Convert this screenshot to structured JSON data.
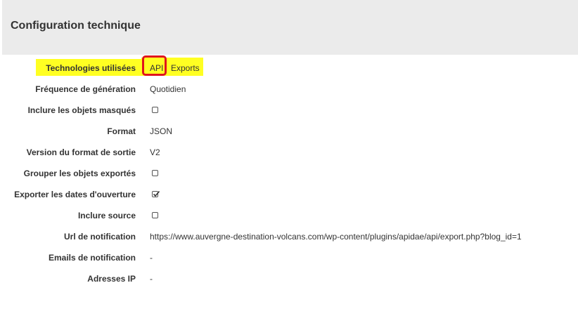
{
  "panel": {
    "title": "Configuration technique"
  },
  "fields": [
    {
      "label": "Technologies utilisées",
      "tags": [
        "API",
        "Exports"
      ]
    },
    {
      "label": "Fréquence de génération",
      "value": "Quotidien"
    },
    {
      "label": "Inclure les objets masqués",
      "checked": false
    },
    {
      "label": "Format",
      "value": "JSON"
    },
    {
      "label": "Version du format de sortie",
      "value": "V2"
    },
    {
      "label": "Grouper les objets exportés",
      "checked": false
    },
    {
      "label": "Exporter les dates d'ouverture",
      "checked": true
    },
    {
      "label": "Inclure source",
      "checked": false
    },
    {
      "label": "Url de notification",
      "value": "https://www.auvergne-destination-volcans.com/wp-content/plugins/apidae/api/export.php?blog_id=1"
    },
    {
      "label": "Emails de notification",
      "value": "-"
    },
    {
      "label": "Adresses IP",
      "value": "-"
    }
  ],
  "colors": {
    "highlight": "#ffff22",
    "annotation": "#e0141d",
    "header_bg": "#ebebeb"
  }
}
